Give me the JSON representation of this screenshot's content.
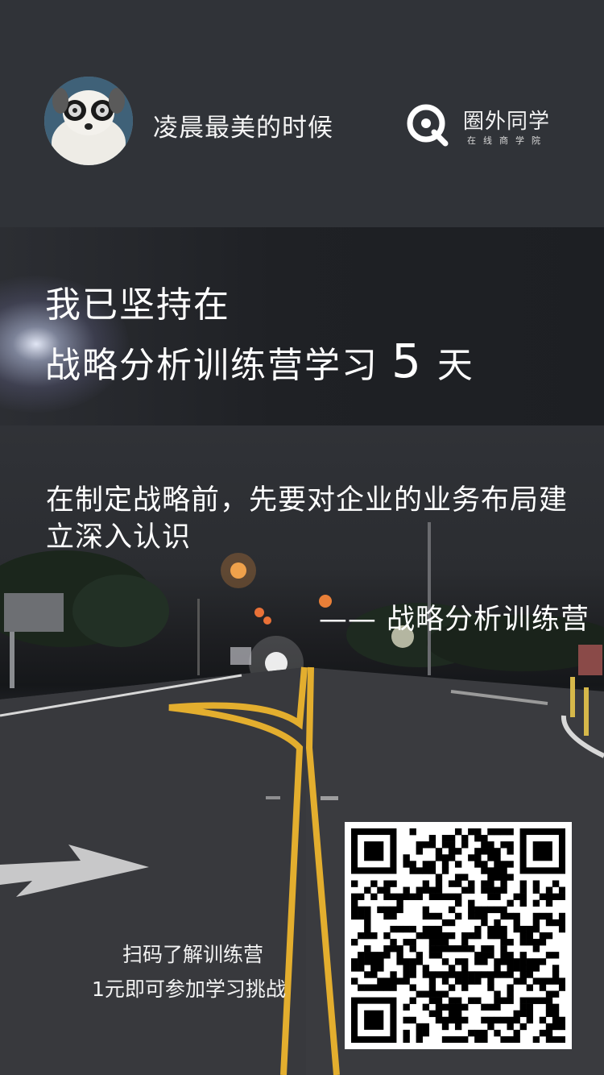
{
  "header": {
    "username": "凌晨最美的时候",
    "brand_name": "圈外同学",
    "brand_sub": "在线商学院"
  },
  "banner": {
    "line1": "我已坚持在",
    "line2_prefix": "战略分析训练营学习",
    "days": "5",
    "unit": "天"
  },
  "quote": {
    "text": "在制定战略前，先要对企业的业务布局建立深入认识",
    "attribution": "—— 战略分析训练营"
  },
  "cta": {
    "line1": "扫码了解训练营",
    "line2": "1元即可参加学习挑战"
  },
  "icons": {
    "brand": "brand-logo-icon",
    "avatar": "avatar-dog-photo",
    "qr": "qr-code"
  },
  "colors": {
    "header_bg": "#303338",
    "banner_bg": "#1f2125",
    "road_line": "#e8b53a"
  }
}
